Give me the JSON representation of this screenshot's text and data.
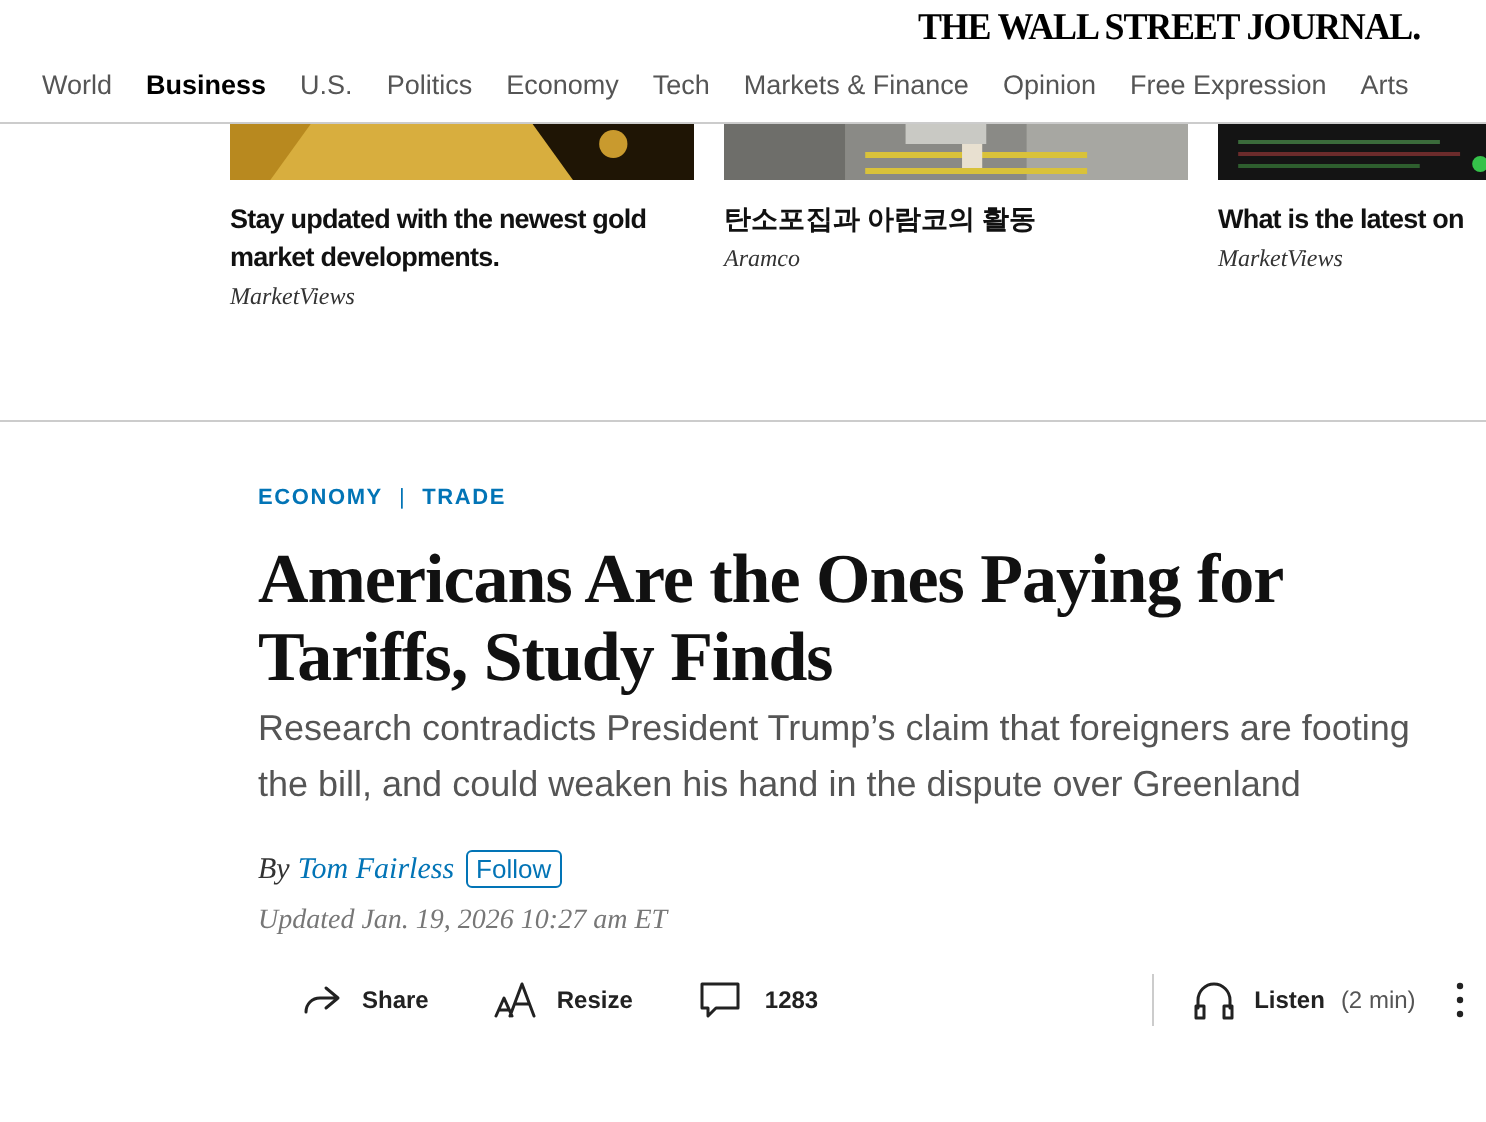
{
  "masthead": {
    "logo": "THE WALL STREET JOURNAL."
  },
  "nav": [
    {
      "label": "World",
      "selected": false
    },
    {
      "label": "Business",
      "selected": true
    },
    {
      "label": "U.S.",
      "selected": false
    },
    {
      "label": "Politics",
      "selected": false
    },
    {
      "label": "Economy",
      "selected": false
    },
    {
      "label": "Tech",
      "selected": false
    },
    {
      "label": "Markets & Finance",
      "selected": false
    },
    {
      "label": "Opinion",
      "selected": false
    },
    {
      "label": "Free Expression",
      "selected": false
    },
    {
      "label": "Arts",
      "selected": false
    }
  ],
  "promos": [
    {
      "headline": "Stay updated with the newest gold market developments.",
      "source": "MarketViews"
    },
    {
      "headline": "탄소포집과 아람코의 활동",
      "source": "Aramco"
    },
    {
      "headline": "What is the latest on",
      "source": "MarketViews"
    }
  ],
  "article": {
    "sections": [
      "ECONOMY",
      "TRADE"
    ],
    "separator": "|",
    "headline": "Americans Are the Ones Paying for Tariffs, Study Finds",
    "dek": "Research contradicts President Trump’s claim that foreigners are footing the bill, and could weaken his hand in the dispute over Greenland",
    "byline_prefix": "By",
    "author": "Tom Fairless",
    "follow": "Follow",
    "updated": "Updated Jan. 19, 2026 10:27 am ET",
    "toolbar": {
      "share": "Share",
      "resize": "Resize",
      "comments": "1283",
      "listen": "Listen",
      "duration": "(2 min)"
    }
  }
}
